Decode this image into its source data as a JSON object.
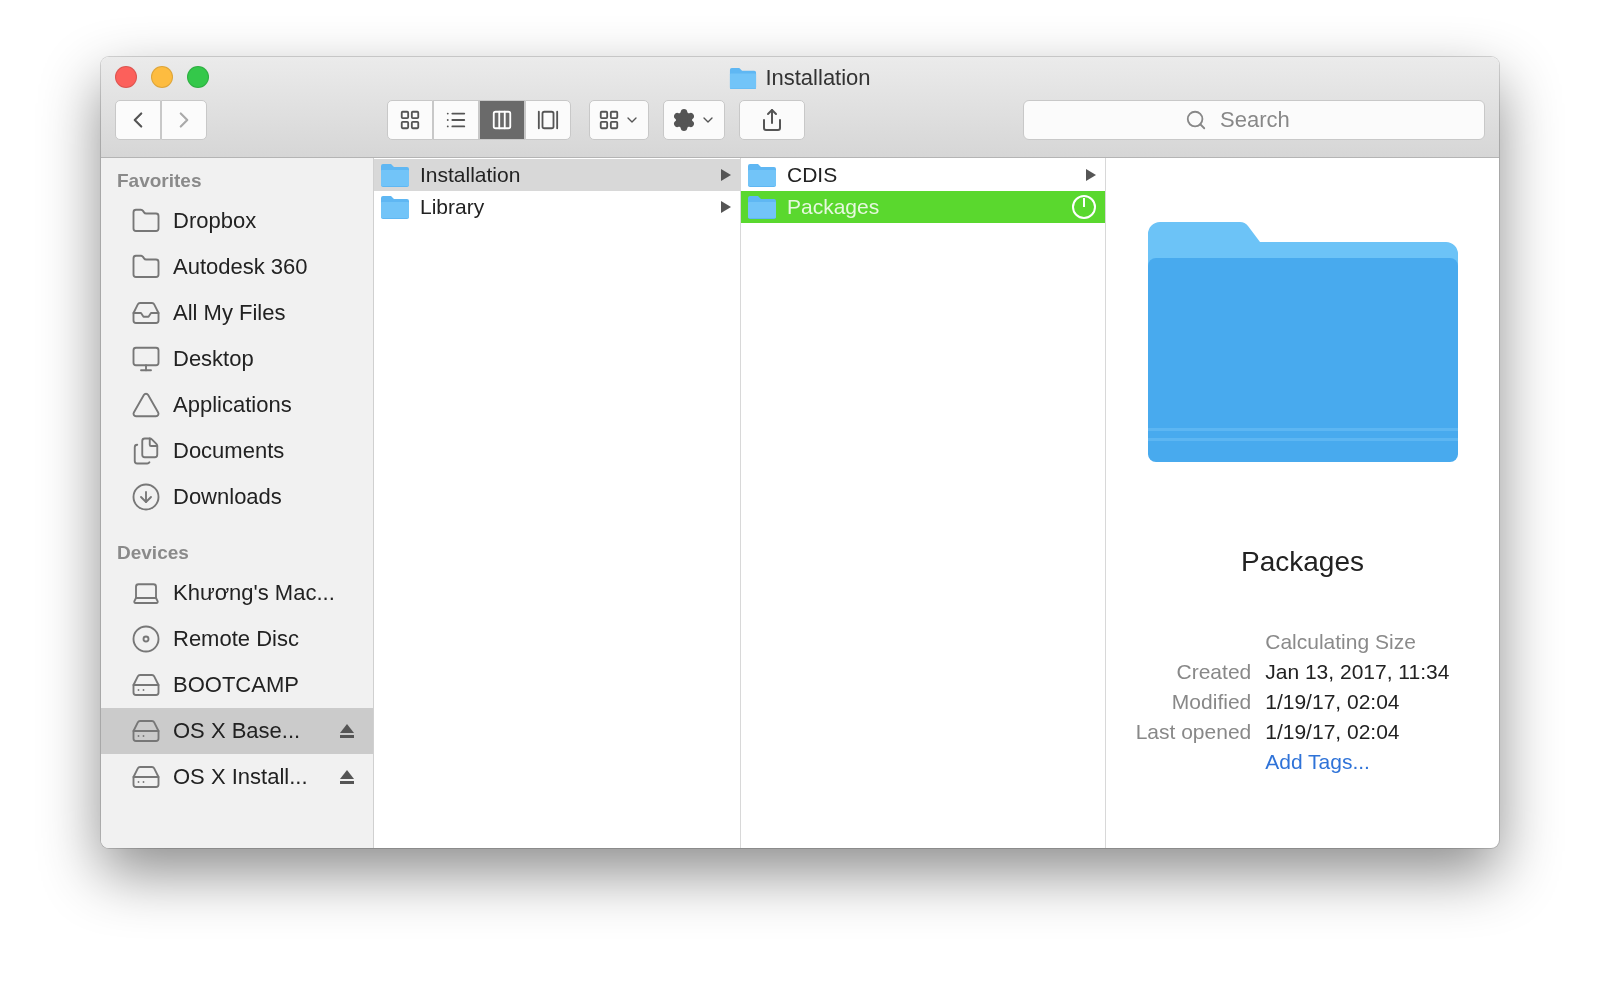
{
  "window": {
    "title": "Installation"
  },
  "toolbar": {
    "view_modes": [
      {
        "kind": "icons",
        "selected": false
      },
      {
        "kind": "list",
        "selected": false
      },
      {
        "kind": "columns",
        "selected": true
      },
      {
        "kind": "coverflow",
        "selected": false
      }
    ],
    "search": {
      "placeholder": "Search"
    }
  },
  "sidebar": {
    "sections": [
      {
        "title": "Favorites",
        "items": [
          {
            "label": "Dropbox",
            "kind": "folder",
            "selected": false,
            "eject": false
          },
          {
            "label": "Autodesk 360",
            "kind": "folder",
            "selected": false,
            "eject": false
          },
          {
            "label": "All My Files",
            "kind": "files",
            "selected": false,
            "eject": false
          },
          {
            "label": "Desktop",
            "kind": "desktop",
            "selected": false,
            "eject": false
          },
          {
            "label": "Applications",
            "kind": "apps",
            "selected": false,
            "eject": false
          },
          {
            "label": "Documents",
            "kind": "documents",
            "selected": false,
            "eject": false
          },
          {
            "label": "Downloads",
            "kind": "downloads",
            "selected": false,
            "eject": false
          }
        ]
      },
      {
        "title": "Devices",
        "items": [
          {
            "label": "Khương's Mac...",
            "kind": "laptop",
            "selected": false,
            "eject": false
          },
          {
            "label": "Remote Disc",
            "kind": "disc",
            "selected": false,
            "eject": false
          },
          {
            "label": "BOOTCAMP",
            "kind": "drive",
            "selected": false,
            "eject": false
          },
          {
            "label": "OS X Base...",
            "kind": "volume",
            "selected": true,
            "eject": true
          },
          {
            "label": "OS X Install...",
            "kind": "volume",
            "selected": false,
            "eject": true
          }
        ]
      }
    ]
  },
  "columns": [
    {
      "focused": false,
      "items": [
        {
          "label": "Installation",
          "selected": true,
          "has_children": true
        },
        {
          "label": "Library",
          "selected": false,
          "has_children": true
        }
      ]
    },
    {
      "focused": true,
      "items": [
        {
          "label": "CDIS",
          "selected": false,
          "has_children": true
        },
        {
          "label": "Packages",
          "selected": true,
          "has_children": false
        }
      ]
    }
  ],
  "preview": {
    "name": "Packages",
    "size": "Calculating Size",
    "fields": [
      {
        "label": "Created",
        "value": "Jan 13, 2017, 11:34"
      },
      {
        "label": "Modified",
        "value": "1/19/17, 02:04"
      },
      {
        "label": "Last opened",
        "value": "1/19/17, 02:04"
      }
    ],
    "add_tags": "Add Tags..."
  }
}
